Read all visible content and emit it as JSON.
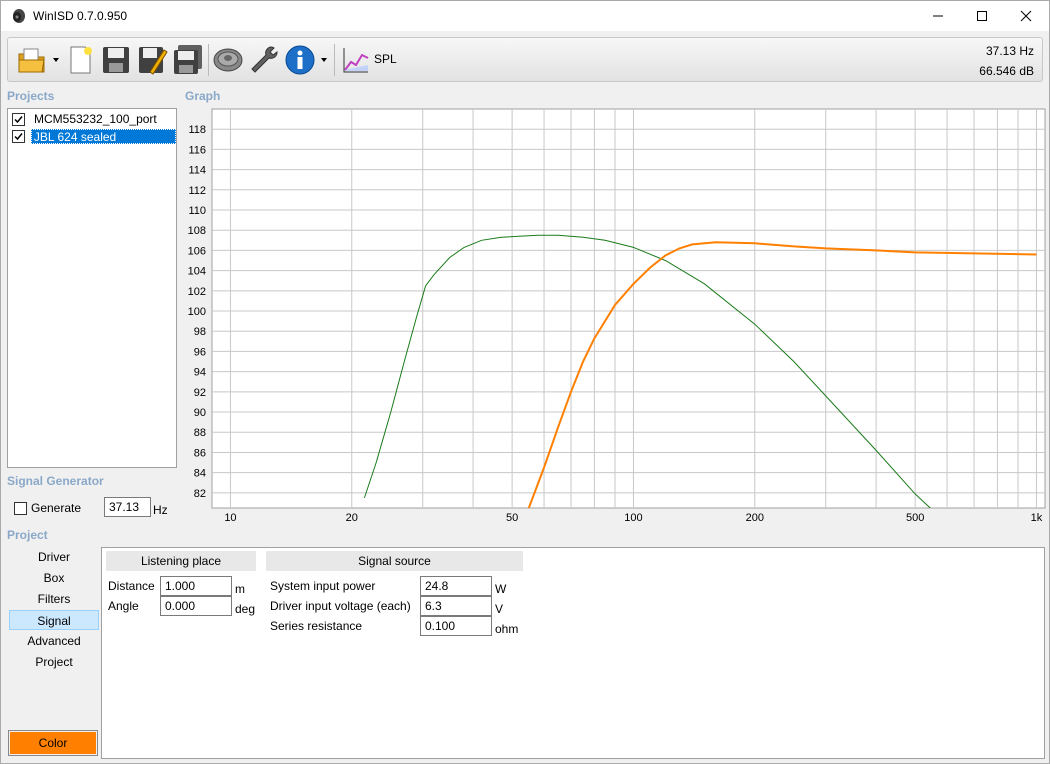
{
  "window": {
    "title": "WinISD 0.7.0.950"
  },
  "toolbar": {
    "spl_label": "SPL",
    "readout_freq": "37.13 Hz",
    "readout_level": "66.546 dB"
  },
  "sections": {
    "projects": "Projects",
    "graph": "Graph",
    "signal_generator": "Signal Generator",
    "project": "Project"
  },
  "projects": [
    {
      "name": "MCM553232_100_port",
      "checked": true,
      "selected": false
    },
    {
      "name": "JBL 624 sealed",
      "checked": true,
      "selected": true
    }
  ],
  "signal_generator": {
    "generate_label": "Generate",
    "generate_checked": false,
    "frequency_value": "37.13",
    "frequency_unit": "Hz"
  },
  "nav": {
    "items": [
      {
        "label": "Driver",
        "active": false
      },
      {
        "label": "Box",
        "active": false
      },
      {
        "label": "Filters",
        "active": false
      },
      {
        "label": "Signal",
        "active": true
      },
      {
        "label": "Advanced",
        "active": false
      },
      {
        "label": "Project",
        "active": false
      }
    ],
    "color_button": "Color",
    "color_value": "#ff8000"
  },
  "listening_place": {
    "header": "Listening place",
    "distance_label": "Distance",
    "distance_value": "1.000",
    "distance_unit": "m",
    "angle_label": "Angle",
    "angle_value": "0.000",
    "angle_unit": "deg"
  },
  "signal_source": {
    "header": "Signal source",
    "power_label": "System input power",
    "power_value": "24.8",
    "power_unit": "W",
    "voltage_label": "Driver input voltage (each)",
    "voltage_value": "6.3",
    "voltage_unit": "V",
    "resistance_label": "Series resistance",
    "resistance_value": "0.100",
    "resistance_unit": "ohm"
  },
  "chart_data": {
    "type": "line",
    "x_scale": "log",
    "xlim": [
      9,
      1050
    ],
    "ylim": [
      80.5,
      120
    ],
    "grid": true,
    "x_ticks": [
      {
        "value": 10,
        "label": "10"
      },
      {
        "value": 20,
        "label": "20"
      },
      {
        "value": 50,
        "label": "50"
      },
      {
        "value": 100,
        "label": "100"
      },
      {
        "value": 200,
        "label": "200"
      },
      {
        "value": 500,
        "label": "500"
      },
      {
        "value": 1000,
        "label": "1k"
      }
    ],
    "y_ticks": [
      82,
      84,
      86,
      88,
      90,
      92,
      94,
      96,
      98,
      100,
      102,
      104,
      106,
      108,
      110,
      112,
      114,
      116,
      118
    ],
    "series": [
      {
        "color": "#1a7a1a",
        "x": [
          21.5,
          23,
          25,
          27,
          29,
          30.5,
          32,
          35,
          38,
          42,
          47,
          52,
          58,
          65,
          75,
          85,
          100,
          120,
          150,
          200,
          250,
          300,
          400,
          500,
          580
        ],
        "y": [
          81.5,
          85,
          90,
          95,
          99.5,
          102.5,
          103.6,
          105.3,
          106.3,
          107.0,
          107.3,
          107.4,
          107.5,
          107.5,
          107.3,
          107.0,
          106.3,
          105.0,
          102.7,
          98.7,
          95.0,
          91.6,
          86.2,
          81.9,
          79.5
        ]
      },
      {
        "color": "#ff8000",
        "x": [
          55,
          60,
          65,
          70,
          75,
          80,
          90,
          100,
          110,
          120,
          130,
          140,
          160,
          200,
          250,
          300,
          400,
          500,
          700,
          1000
        ],
        "y": [
          80.5,
          84.5,
          88.5,
          92.0,
          95.0,
          97.3,
          100.6,
          102.7,
          104.3,
          105.5,
          106.2,
          106.6,
          106.8,
          106.7,
          106.4,
          106.2,
          106.0,
          105.8,
          105.7,
          105.6
        ]
      }
    ]
  }
}
